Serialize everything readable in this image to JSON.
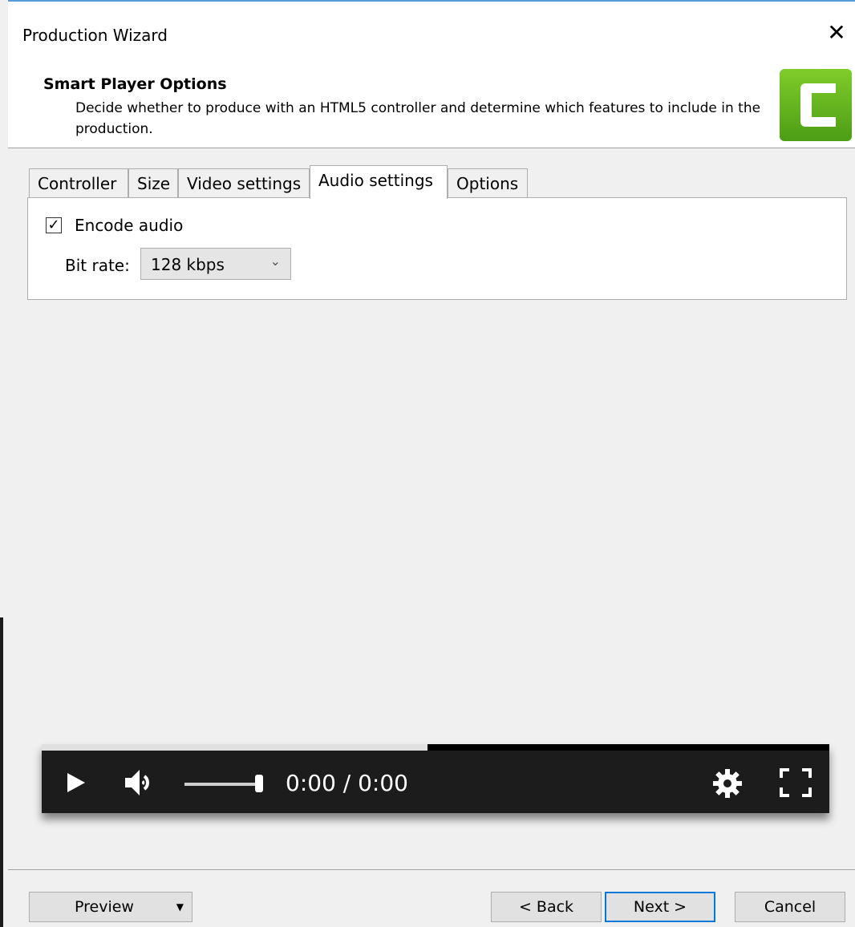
{
  "window": {
    "title": "Production Wizard",
    "close_symbol": "✕"
  },
  "header": {
    "title": "Smart Player Options",
    "description": "Decide whether to produce with an HTML5 controller and determine which features to include in the production."
  },
  "tabs": [
    {
      "label": "Controller",
      "active": false
    },
    {
      "label": "Size",
      "active": false
    },
    {
      "label": "Video settings",
      "active": false
    },
    {
      "label": "Audio settings",
      "active": true
    },
    {
      "label": "Options",
      "active": false
    }
  ],
  "audio": {
    "encode_label": "Encode audio",
    "encode_checked": true,
    "bitrate_label": "Bit rate:",
    "bitrate_value": "128 kbps"
  },
  "player": {
    "time": "0:00 / 0:00",
    "progress_fraction": 0.49,
    "volume_fraction": 0.95
  },
  "buttons": {
    "preview": "Preview",
    "back": "< Back",
    "next": "Next >",
    "cancel": "Cancel"
  },
  "colors": {
    "accent": "#0078d7",
    "logo_green": "#5fb31f",
    "player_bg": "#1c1c1c"
  },
  "icons": [
    "close-icon",
    "camtasia-logo-icon",
    "checkmark-icon",
    "chevron-down-icon",
    "play-icon",
    "volume-icon",
    "settings-gear-icon",
    "fullscreen-icon",
    "dropdown-caret-icon"
  ]
}
